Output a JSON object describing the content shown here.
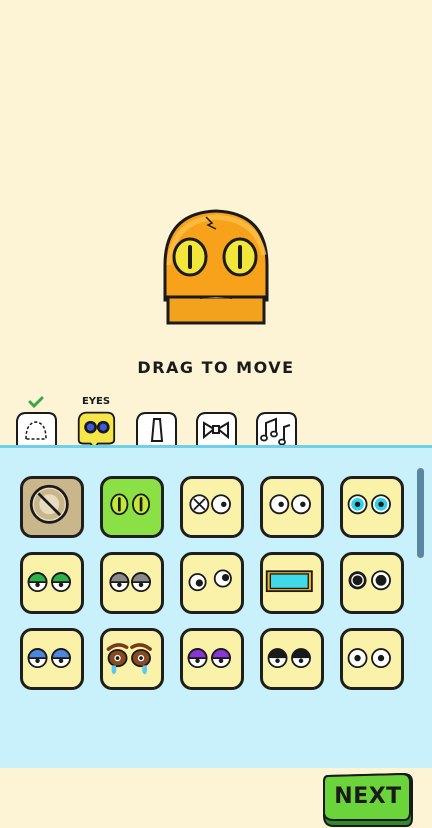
{
  "preview": {
    "instruction": "DRAG TO MOVE",
    "character_color": "#f7a21a"
  },
  "tabs": [
    {
      "name": "head",
      "icon": "head-outline-icon",
      "completed": true
    },
    {
      "name": "eyes",
      "label": "EYES",
      "icon": "eyes-icon",
      "selected": true
    },
    {
      "name": "nose",
      "icon": "nose-icon"
    },
    {
      "name": "bowtie",
      "icon": "bowtie-icon"
    },
    {
      "name": "music",
      "icon": "music-notes-icon"
    }
  ],
  "next_button": {
    "label": "NEXT",
    "color": "#6ad43a"
  },
  "eye_options": [
    {
      "style": "none",
      "icon": "no-eyes-icon"
    },
    {
      "style": "green-cat-eyes",
      "icon": "green-cat-eyes-icon",
      "selected": true
    },
    {
      "style": "x-and-dot",
      "icon": "x-eye-icon"
    },
    {
      "style": "small-dots",
      "icon": "dot-eyes-icon"
    },
    {
      "style": "cyan-eyes",
      "icon": "cyan-eyes-icon"
    },
    {
      "style": "green-lids",
      "icon": "green-lid-eyes-icon"
    },
    {
      "style": "grey-lids",
      "icon": "grey-lid-eyes-icon"
    },
    {
      "style": "googly",
      "icon": "googly-eyes-icon"
    },
    {
      "style": "visor",
      "icon": "visor-icon"
    },
    {
      "style": "black-ring",
      "icon": "black-ring-eyes-icon"
    },
    {
      "style": "blue-lids",
      "icon": "blue-lid-eyes-icon"
    },
    {
      "style": "crying",
      "icon": "crying-eyes-icon"
    },
    {
      "style": "purple-lids",
      "icon": "purple-lid-eyes-icon"
    },
    {
      "style": "black-lids",
      "icon": "black-lid-eyes-icon"
    },
    {
      "style": "round-plain",
      "icon": "round-eyes-icon"
    }
  ]
}
